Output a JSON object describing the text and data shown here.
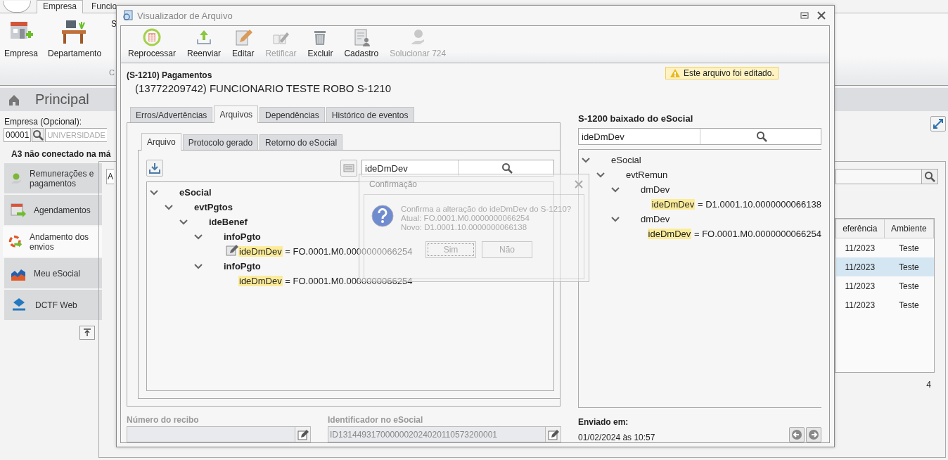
{
  "app": {
    "tabs": [
      {
        "label": "Empresa",
        "selected": true
      },
      {
        "label": "Funcio",
        "selected": false
      }
    ],
    "ribbon": [
      {
        "label": "Empresa"
      },
      {
        "label": "Departamento"
      },
      {
        "label": "S"
      }
    ],
    "ribbon_group": "C",
    "home_tab": "Principal",
    "company_label": "Empresa (Opcional):",
    "company_code": "00001",
    "company_name": "UNIVERSIDADE",
    "certificate_status": "A3 não conectado na má",
    "sidebar": [
      {
        "label": "Remunerações e pagamentos",
        "selected": false
      },
      {
        "label": "Agendamentos",
        "selected": false
      },
      {
        "label": "Andamento dos envios",
        "selected": true
      },
      {
        "label": "Meu eSocial",
        "selected": false
      },
      {
        "label": "DCTF Web",
        "selected": false
      }
    ],
    "filter_value": "A",
    "table": {
      "columns": [
        "eferência",
        "Ambiente"
      ],
      "rows": [
        {
          "cells": [
            "11/2023",
            "Teste"
          ],
          "selected": false
        },
        {
          "cells": [
            "11/2023",
            "Teste"
          ],
          "selected": true
        },
        {
          "cells": [
            "11/2023",
            "Teste"
          ],
          "selected": false
        },
        {
          "cells": [
            "11/2023",
            "Teste"
          ],
          "selected": false
        }
      ]
    },
    "count": "4"
  },
  "window": {
    "title": "Visualizador de Arquivo",
    "toolbar": [
      {
        "label": "Reprocessar",
        "disabled": false
      },
      {
        "label": "Reenviar",
        "disabled": false
      },
      {
        "label": "Editar",
        "disabled": false
      },
      {
        "label": "Retificar",
        "disabled": true
      },
      {
        "label": "Excluir",
        "disabled": false
      },
      {
        "label": "Cadastro",
        "disabled": false
      },
      {
        "label": "Solucionar 724",
        "disabled": true
      }
    ],
    "event": "(S-1210) Pagamentos",
    "employee": "(13772209742) FUNCIONARIO TESTE ROBO S-1210",
    "notice": "Este arquivo foi editado.",
    "tabs": [
      {
        "label": "Erros/Advertências",
        "selected": false
      },
      {
        "label": "Arquivos",
        "selected": true
      },
      {
        "label": "Dependências",
        "selected": false
      },
      {
        "label": "Histórico de eventos",
        "selected": false
      }
    ],
    "subtabs": [
      {
        "label": "Arquivo",
        "selected": true
      },
      {
        "label": "Protocolo gerado",
        "selected": false
      },
      {
        "label": "Retorno do eSocial",
        "selected": false
      }
    ],
    "search": "ideDmDev",
    "tree": [
      {
        "label": "eSocial",
        "children": [
          {
            "label": "evtPgtos",
            "children": [
              {
                "label": "ideBenef",
                "children": [
                  {
                    "label": "infoPgto",
                    "children": [
                      {
                        "key": "ideDmDev",
                        "operator": "=",
                        "value": "FO.0001.M0.0000000066254",
                        "edited": true,
                        "matched": true
                      }
                    ]
                  },
                  {
                    "label": "infoPgto",
                    "children": [
                      {
                        "key": "ideDmDev",
                        "operator": "=",
                        "value": "FO.0001.M0.0000000066254",
                        "edited": false,
                        "matched": true
                      }
                    ]
                  }
                ]
              }
            ]
          }
        ]
      }
    ],
    "receipt_label": "Número do recibo",
    "id_label": "Identificador no eSocial",
    "id_value": "ID1314493170000002024020110573200001",
    "sent_label": "Enviado em:",
    "sent_value": "01/02/2024 às 10:57",
    "compare": {
      "title": "S-1200 baixado do eSocial",
      "search": "ideDmDev",
      "tree": [
        {
          "label": "eSocial",
          "children": [
            {
              "label": "evtRemun",
              "children": [
                {
                  "label": "dmDev",
                  "children": [
                    {
                      "key": "ideDmDev",
                      "operator": "=",
                      "value": "D1.0001.10.0000000066138",
                      "edited": false,
                      "matched": true
                    }
                  ]
                },
                {
                  "label": "dmDev",
                  "children": [
                    {
                      "key": "ideDmDev",
                      "operator": "=",
                      "value": "FO.0001.M0.0000000066254",
                      "edited": false,
                      "matched": true
                    }
                  ]
                }
              ]
            }
          ]
        }
      ]
    }
  },
  "dialog": {
    "title": "Confirmação",
    "lines": [
      "Confirma a alteração do ideDmDev do S-1210?",
      "Atual: FO.0001.M0.0000000066254",
      "Novo: D1.0001.10.0000000066138"
    ],
    "buttons": [
      {
        "label": "Sim",
        "focused": true
      },
      {
        "label": "Não",
        "focused": false
      }
    ]
  }
}
